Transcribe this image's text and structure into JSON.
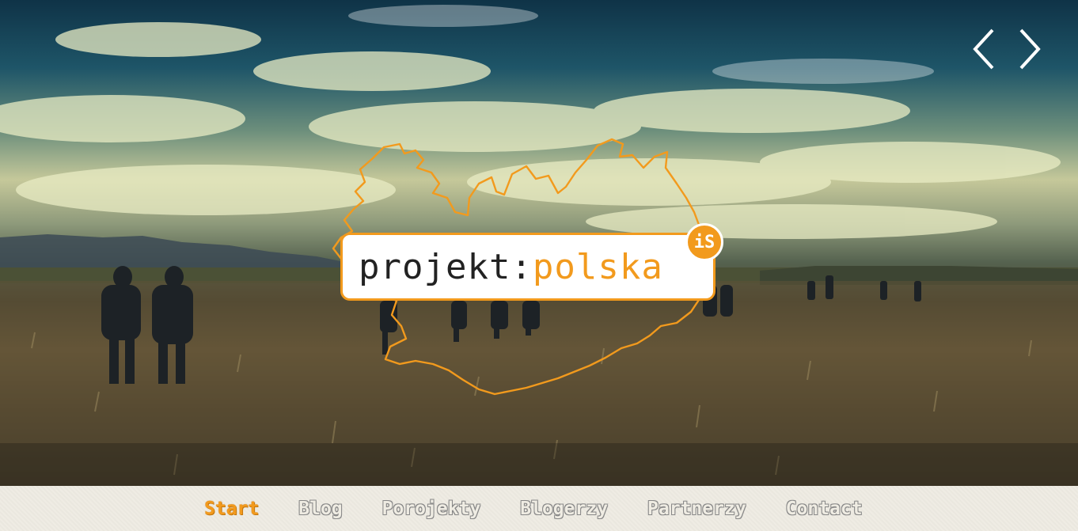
{
  "slider": {
    "prev_icon": "chevron-left-icon",
    "next_icon": "chevron-right-icon"
  },
  "logo": {
    "text_dark": "projekt:",
    "text_orange": "polska",
    "badge": "iS",
    "map_outline_icon": "iceland-map-outline-icon"
  },
  "menu": {
    "items": [
      {
        "label": "Start",
        "active": true
      },
      {
        "label": "Blog",
        "active": false
      },
      {
        "label": "Porojekty",
        "active": false
      },
      {
        "label": "Blogerzy",
        "active": false
      },
      {
        "label": "Partnerzy",
        "active": false
      },
      {
        "label": "Contact",
        "active": false
      }
    ]
  },
  "colors": {
    "accent": "#f29a1d",
    "menu_bg": "#efece3"
  }
}
